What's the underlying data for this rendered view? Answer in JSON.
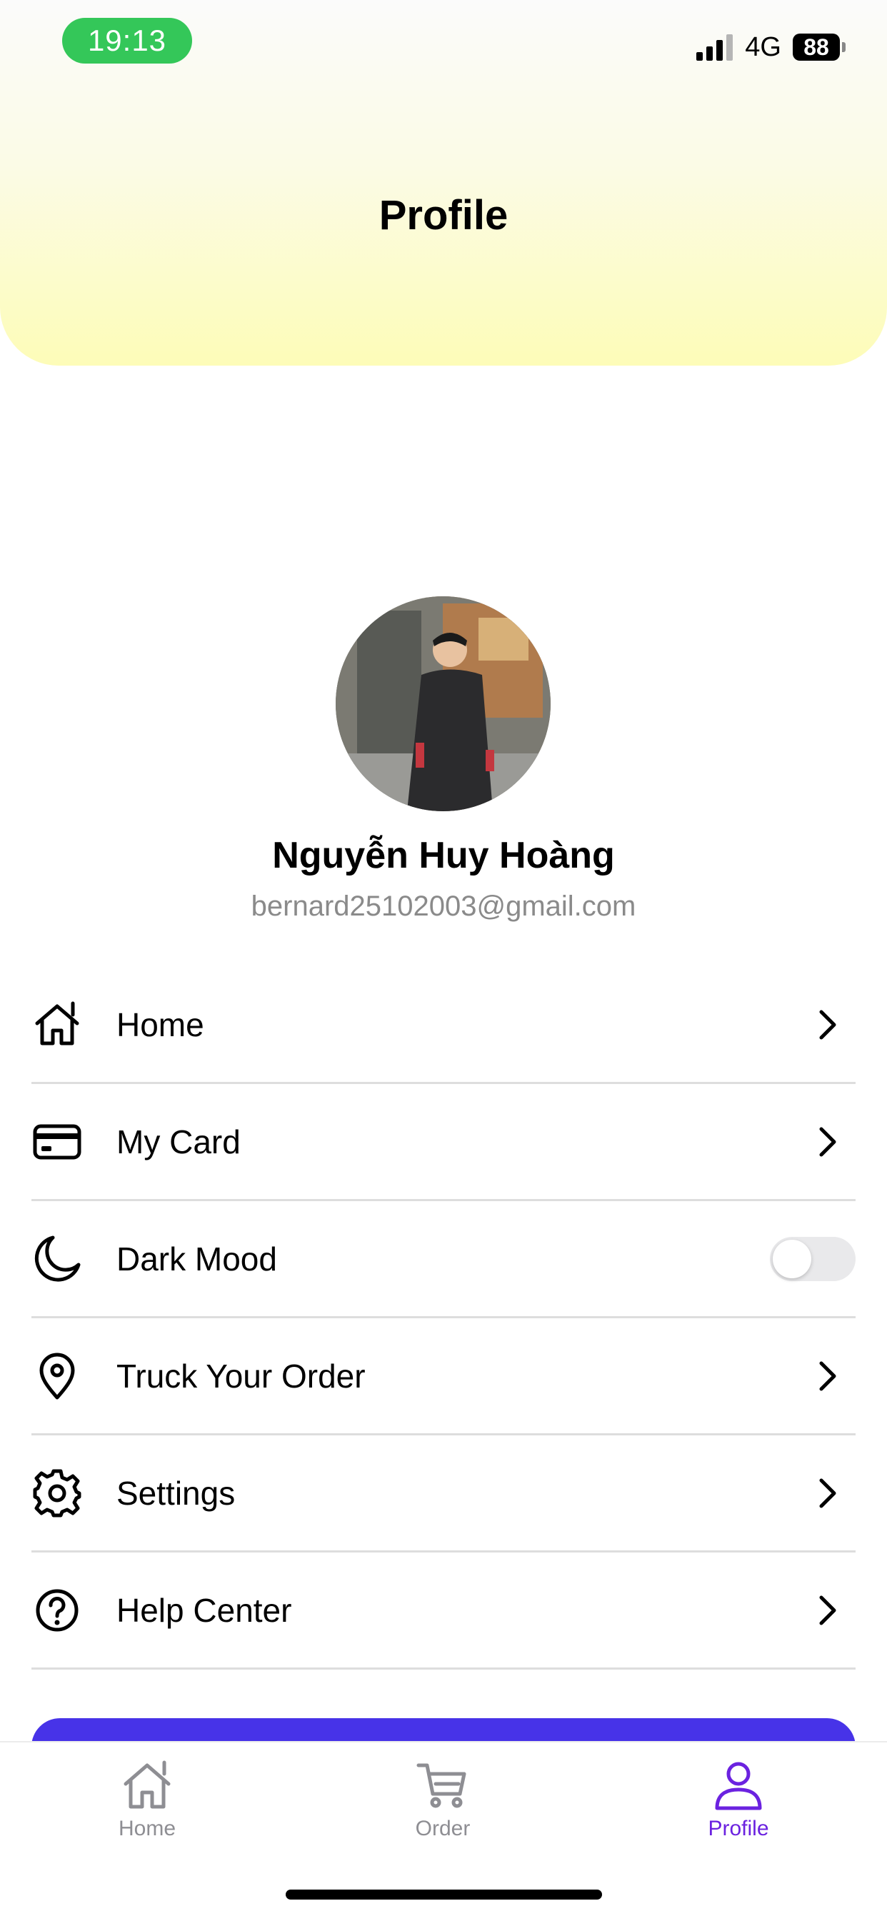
{
  "status_bar": {
    "time": "19:13",
    "network": "4G",
    "battery": "88"
  },
  "header": {
    "title": "Profile"
  },
  "profile": {
    "name": "Nguyễn Huy Hoàng",
    "email": "bernard25102003@gmail.com"
  },
  "menu": {
    "items": [
      {
        "label": "Home",
        "icon": "home-icon"
      },
      {
        "label": "My Card",
        "icon": "credit-card-icon"
      },
      {
        "label": "Dark Mood",
        "icon": "moon-icon",
        "toggle": false
      },
      {
        "label": "Truck Your Order",
        "icon": "location-pin-icon"
      },
      {
        "label": "Settings",
        "icon": "gear-icon"
      },
      {
        "label": "Help Center",
        "icon": "help-circle-icon"
      }
    ]
  },
  "tab_bar": {
    "tabs": [
      {
        "label": "Home",
        "icon": "home-icon",
        "active": false
      },
      {
        "label": "Order",
        "icon": "cart-icon",
        "active": false
      },
      {
        "label": "Profile",
        "icon": "user-icon",
        "active": true
      }
    ]
  },
  "colors": {
    "accent": "#6b22e0",
    "button": "#4733e8",
    "status_time_bg": "#34c759",
    "header_gradient_end": "#fdfcb8"
  }
}
